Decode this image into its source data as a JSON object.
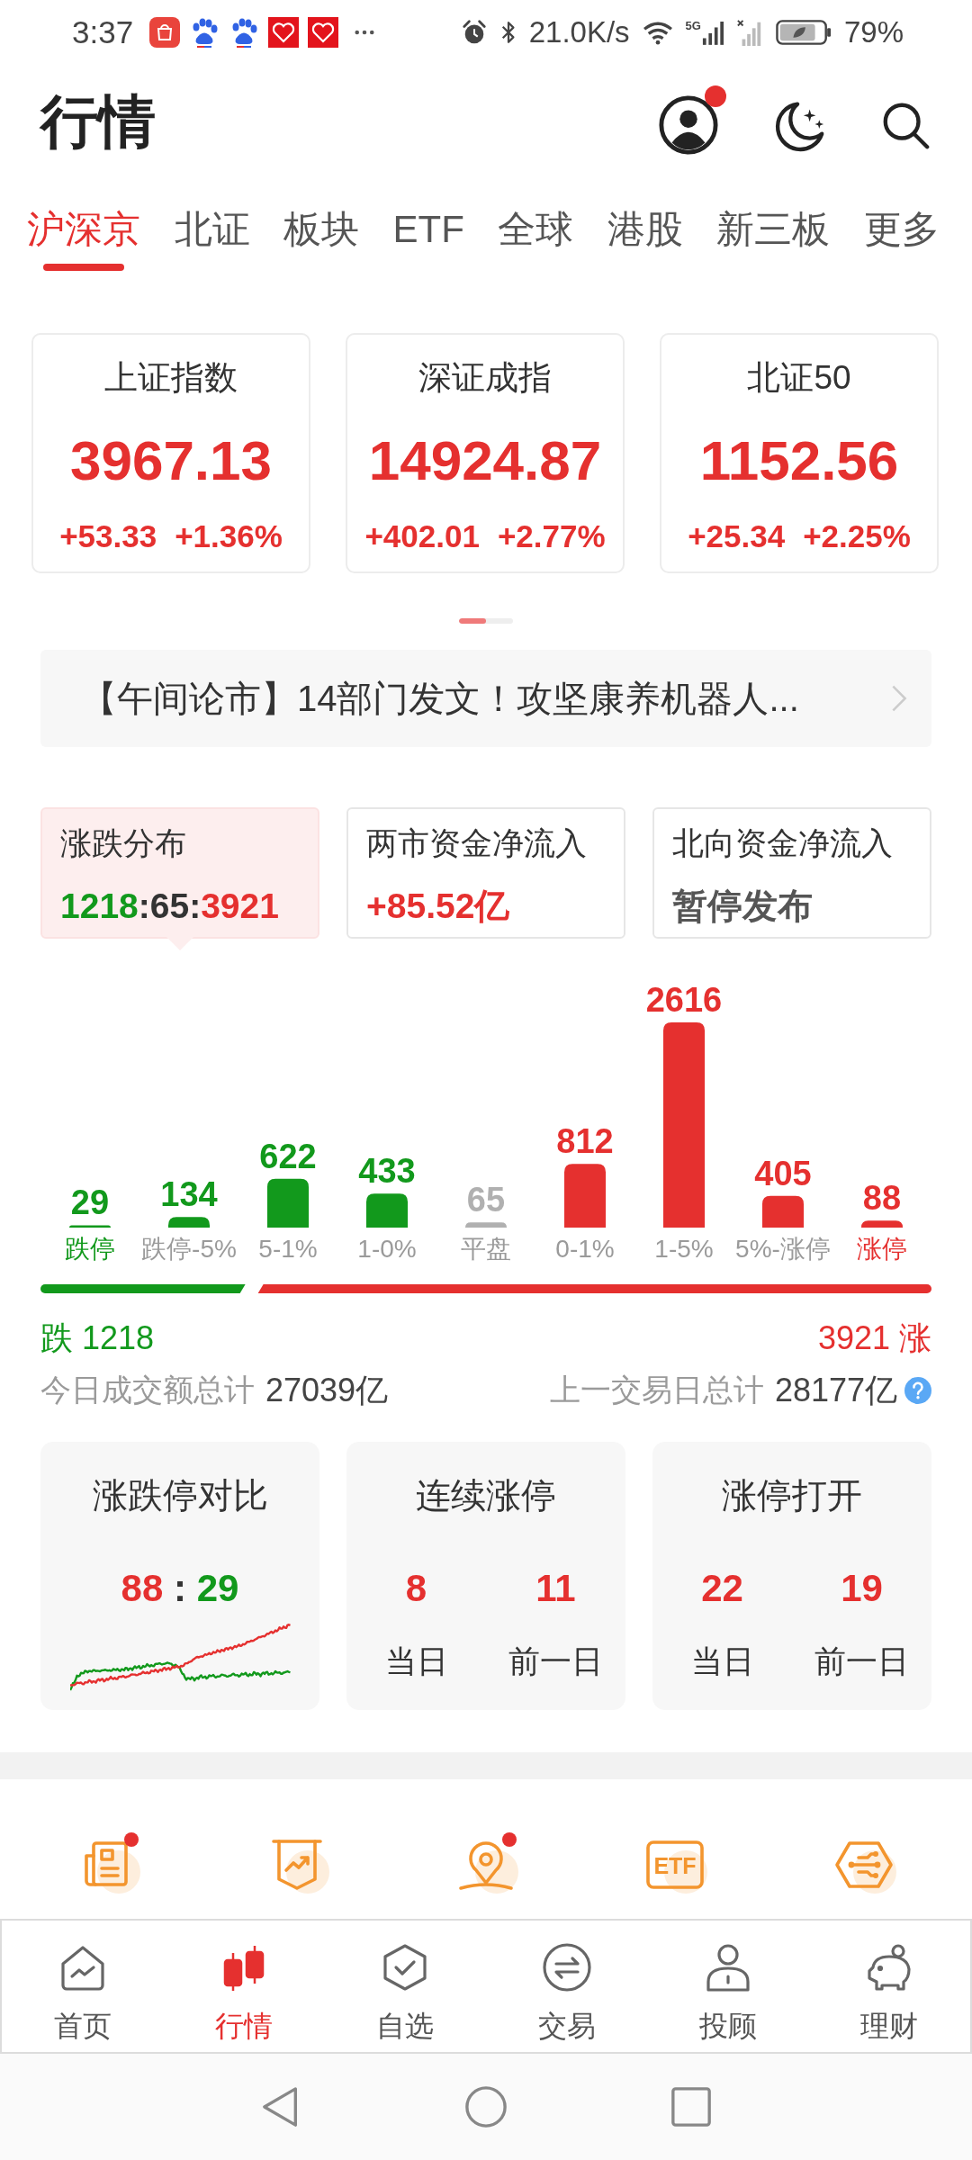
{
  "status_bar": {
    "time": "3:37",
    "net_speed": "21.0K/s",
    "network_type": "5G",
    "battery": "79%"
  },
  "header": {
    "title": "行情",
    "avatar_badge": true
  },
  "tabs": [
    {
      "label": "沪深京",
      "selected": true
    },
    {
      "label": "北证",
      "selected": false
    },
    {
      "label": "板块",
      "selected": false
    },
    {
      "label": "ETF",
      "selected": false
    },
    {
      "label": "全球",
      "selected": false
    },
    {
      "label": "港股",
      "selected": false
    },
    {
      "label": "新三板",
      "selected": false
    },
    {
      "label": "更多",
      "selected": false
    }
  ],
  "indices": [
    {
      "name": "上证指数",
      "value": "3967.13",
      "change": "+53.33",
      "change_pct": "+1.36%"
    },
    {
      "name": "深证成指",
      "value": "14924.87",
      "change": "+402.01",
      "change_pct": "+2.77%"
    },
    {
      "name": "北证50",
      "value": "1152.56",
      "change": "+25.34",
      "change_pct": "+2.25%"
    }
  ],
  "news": {
    "text": "【午间论市】14部门发文！攻坚康养机器人..."
  },
  "stat_cards": [
    {
      "title": "涨跌分布",
      "selected": true,
      "value": [
        {
          "text": "1218",
          "color": "#12991c"
        },
        {
          "text": ":65:",
          "color": "#333333"
        },
        {
          "text": "3921",
          "color": "#e5302f"
        }
      ]
    },
    {
      "title": "两市资金净流入",
      "selected": false,
      "value": [
        {
          "text": "+85.52亿",
          "color": "#e5302f"
        }
      ]
    },
    {
      "title": "北向资金净流入",
      "selected": false,
      "value": [
        {
          "text": "暂停发布",
          "color": "#555555"
        }
      ]
    }
  ],
  "distribution": {
    "chart_data": {
      "type": "bar",
      "categories": [
        "跌停",
        "跌停-5%",
        "5-1%",
        "1-0%",
        "平盘",
        "0-1%",
        "1-5%",
        "5%-涨停",
        "涨停"
      ],
      "series": [
        {
          "values": [
            29,
            134,
            622,
            433,
            65,
            812,
            2616,
            405,
            88
          ]
        }
      ],
      "data_labels": true
    },
    "bars": [
      {
        "color": "#12991c"
      },
      {
        "color": "#12991c"
      },
      {
        "color": "#12991c"
      },
      {
        "color": "#12991c"
      },
      {
        "color": "#b0b0b0"
      },
      {
        "color": "#e5302f"
      },
      {
        "color": "#e5302f"
      },
      {
        "color": "#e5302f"
      },
      {
        "color": "#e5302f"
      }
    ]
  },
  "ratio_bar": {
    "level": 0.237,
    "fall": "跌 1218",
    "rise": "3921 涨"
  },
  "turnover": {
    "today_label": "今日成交额总计",
    "today_value": "27039亿",
    "previous_label": "上一交易日总计",
    "previous_value": "28177亿"
  },
  "limit_cards": [
    {
      "kind": "compare",
      "title": "涨跌停对比",
      "rise": "88",
      "separator": ":",
      "fall": "29"
    },
    {
      "kind": "pair",
      "title": "连续涨停",
      "items": [
        {
          "value": "8",
          "label": "当日"
        },
        {
          "value": "11",
          "label": "前一日"
        }
      ]
    },
    {
      "kind": "pair",
      "title": "涨停打开",
      "items": [
        {
          "value": "22",
          "label": "当日"
        },
        {
          "value": "19",
          "label": "前一日"
        }
      ]
    }
  ],
  "shortcuts": [
    {
      "kind": "news",
      "badge": true
    },
    {
      "kind": "trend",
      "badge": false
    },
    {
      "kind": "pin",
      "badge": true
    },
    {
      "kind": "etf",
      "label": "ETF",
      "badge": false
    },
    {
      "kind": "hub",
      "badge": false
    }
  ],
  "bottom_nav": [
    {
      "kind": "home",
      "label": "首页",
      "selected": false
    },
    {
      "kind": "market",
      "label": "行情",
      "selected": true
    },
    {
      "kind": "watchlist",
      "label": "自选",
      "selected": false
    },
    {
      "kind": "trade",
      "label": "交易",
      "selected": false
    },
    {
      "kind": "advisor",
      "label": "投顾",
      "selected": false
    },
    {
      "kind": "wealth",
      "label": "理财",
      "selected": false
    }
  ]
}
